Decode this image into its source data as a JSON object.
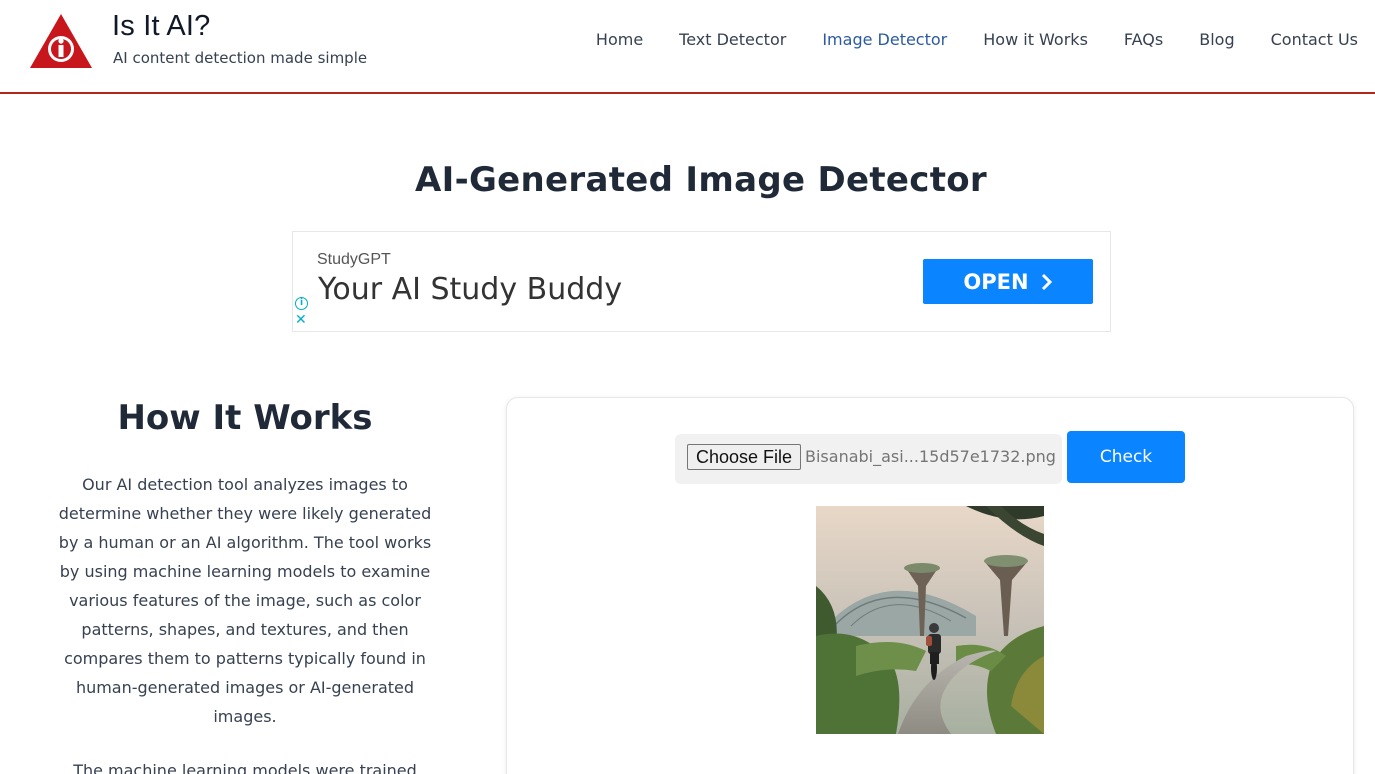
{
  "brand": {
    "title": "Is It AI?",
    "tagline": "AI content detection made simple",
    "logo_icon": "red-triangle-info-logo"
  },
  "nav": {
    "items": [
      {
        "label": "Home",
        "active": false
      },
      {
        "label": "Text Detector",
        "active": false
      },
      {
        "label": "Image Detector",
        "active": true
      },
      {
        "label": "How it Works",
        "active": false
      },
      {
        "label": "FAQs",
        "active": false
      },
      {
        "label": "Blog",
        "active": false
      },
      {
        "label": "Contact Us",
        "active": false
      }
    ]
  },
  "page": {
    "title": "AI-Generated Image Detector"
  },
  "ad": {
    "brand": "StudyGPT",
    "headline": "Your AI Study Buddy",
    "button_label": "OPEN",
    "button_icon": "chevron-right-icon"
  },
  "how_it_works": {
    "title": "How It Works",
    "paragraph1": "Our AI detection tool analyzes images to determine whether they were likely generated by a human or an AI algorithm. The tool works by using machine learning models to examine various features of the image, such as color patterns, shapes, and textures, and then compares them to patterns typically found in human-generated images or AI-generated images.",
    "paragraph2": "The machine learning models were trained"
  },
  "tool": {
    "choose_file_label": "Choose File",
    "file_name": "Bisanabi_asi...15d57e1732.png",
    "check_label": "Check",
    "preview_description_icon": "uploaded-image-preview"
  },
  "colors": {
    "accent": "#0a84ff",
    "header_border": "#b3261e",
    "nav_active": "#2c5aa0"
  }
}
